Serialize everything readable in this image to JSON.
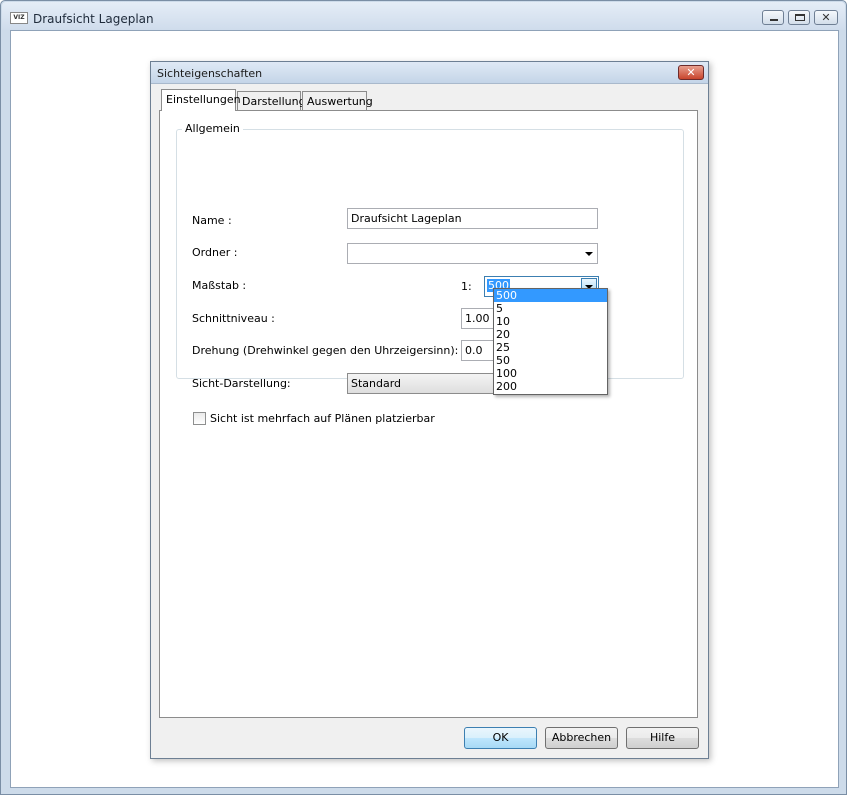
{
  "outer_window": {
    "title": "Draufsicht Lageplan",
    "app_icon_text": "VIZ"
  },
  "dialog": {
    "title": "Sichteigenschaften",
    "tabs": [
      {
        "label": "Einstellungen",
        "active": true
      },
      {
        "label": "Darstellung",
        "active": false
      },
      {
        "label": "Auswertung",
        "active": false
      }
    ],
    "group_label": "Allgemein",
    "name": {
      "label": "Name :",
      "value": "Draufsicht Lageplan"
    },
    "ordner": {
      "label": "Ordner :",
      "value": ""
    },
    "massstab": {
      "label": "Maßstab :",
      "prefix": "1:",
      "value": "500",
      "options": [
        "500",
        "5",
        "10",
        "20",
        "25",
        "50",
        "100",
        "200"
      ],
      "selected_index": 0
    },
    "schnittniveau": {
      "label": "Schnittniveau :",
      "value": "1.00"
    },
    "drehung": {
      "label": "Drehung (Drehwinkel gegen den Uhrzeigersinn):",
      "value": "0.0"
    },
    "sicht_darstellung": {
      "label": "Sicht-Darstellung:",
      "value": "Standard"
    },
    "mehrfach": {
      "label": "Sicht ist mehrfach auf Plänen platzierbar",
      "checked": false
    },
    "buttons": {
      "ok": "OK",
      "abbrechen": "Abbrechen",
      "hilfe": "Hilfe"
    }
  },
  "colors": {
    "selection": "#3399ff",
    "window_frame": "#cddbea"
  }
}
